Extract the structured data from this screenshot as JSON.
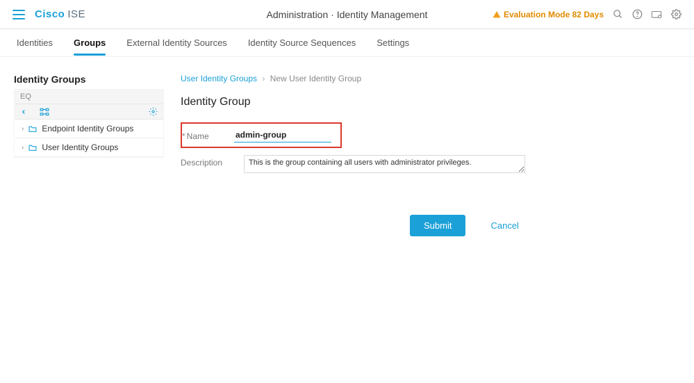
{
  "header": {
    "brand_primary": "Cisco",
    "brand_secondary": "ISE",
    "page_title": "Administration · Identity Management",
    "eval_text": "Evaluation Mode 82 Days"
  },
  "tabs": {
    "items": [
      "Identities",
      "Groups",
      "External Identity Sources",
      "Identity Source Sequences",
      "Settings"
    ],
    "active_index": 1
  },
  "sidebar": {
    "title": "Identity Groups",
    "items": [
      {
        "label": "Endpoint Identity Groups"
      },
      {
        "label": "User Identity Groups"
      }
    ]
  },
  "breadcrumb": {
    "link": "User Identity Groups",
    "current": "New User Identity Group"
  },
  "page_heading": "Identity Group",
  "form": {
    "name_label": "Name",
    "name_value": "admin-group",
    "desc_label": "Description",
    "desc_value": "This is the group containing all users with administrator privileges."
  },
  "actions": {
    "submit": "Submit",
    "cancel": "Cancel"
  }
}
